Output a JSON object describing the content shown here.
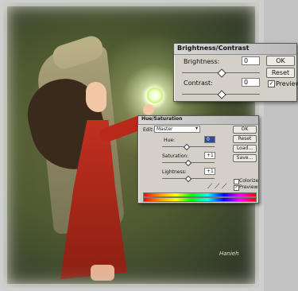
{
  "brightness_contrast": {
    "title": "Brightness/Contrast",
    "brightness_label": "Brightness:",
    "brightness_value": "0",
    "contrast_label": "Contrast:",
    "contrast_value": "0",
    "ok_label": "OK",
    "reset_label": "Reset",
    "preview_label": "Preview",
    "preview_checked": true
  },
  "hue_saturation": {
    "title": "Hue/Saturation",
    "edit_label": "Edit:",
    "edit_value": "Master",
    "hue_label": "Hue:",
    "hue_value": "0",
    "saturation_label": "Saturation:",
    "saturation_value": "+1",
    "lightness_label": "Lightness:",
    "lightness_value": "+1",
    "ok_label": "OK",
    "reset_label": "Reset",
    "load_label": "Load...",
    "save_label": "Save...",
    "colorize_label": "Colorize",
    "preview_label": "Preview",
    "colorize_checked": false,
    "preview_checked": true
  },
  "canvas": {
    "signature": "Hanieh"
  }
}
